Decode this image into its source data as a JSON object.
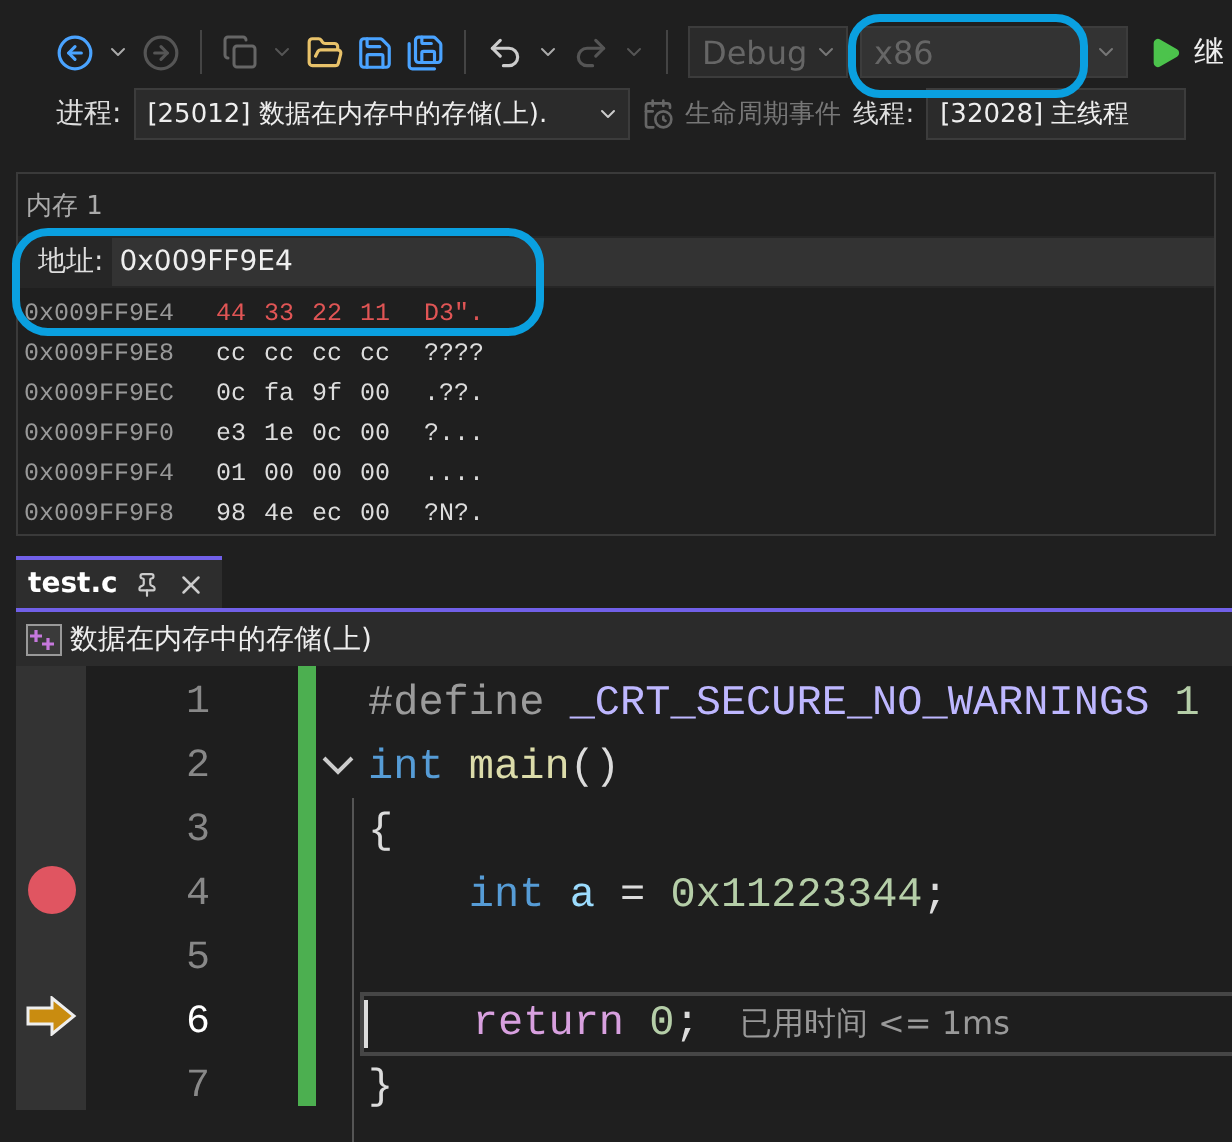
{
  "toolbar": {
    "configuration": "Debug",
    "platform": "x86",
    "run_label": "继"
  },
  "debug_location": {
    "process_label": "进程:",
    "process": "[25012] 数据在内存中的存储(上).",
    "lifecycle": "生命周期事件",
    "thread_label": "线程:",
    "thread": "[32028] 主线程"
  },
  "memory": {
    "title": "内存 1",
    "address_label": "地址:",
    "address": "0x009FF9E4",
    "rows": [
      {
        "address": "0x009FF9E4",
        "bytes": [
          "44",
          "33",
          "22",
          "11"
        ],
        "chars": "D3\".",
        "changed": true
      },
      {
        "address": "0x009FF9E8",
        "bytes": [
          "cc",
          "cc",
          "cc",
          "cc"
        ],
        "chars": "????",
        "changed": false
      },
      {
        "address": "0x009FF9EC",
        "bytes": [
          "0c",
          "fa",
          "9f",
          "00"
        ],
        "chars": ".??.",
        "changed": false
      },
      {
        "address": "0x009FF9F0",
        "bytes": [
          "e3",
          "1e",
          "0c",
          "00"
        ],
        "chars": "?...",
        "changed": false
      },
      {
        "address": "0x009FF9F4",
        "bytes": [
          "01",
          "00",
          "00",
          "00"
        ],
        "chars": "....",
        "changed": false
      },
      {
        "address": "0x009FF9F8",
        "bytes": [
          "98",
          "4e",
          "ec",
          "00"
        ],
        "chars": "?N?.",
        "changed": false
      }
    ]
  },
  "editor": {
    "tab": {
      "title": "test.c",
      "selected": true
    },
    "navigation": "数据在内存中的存储(上)",
    "lines": [
      {
        "number": "1",
        "breakpoint": false,
        "current": false,
        "fold": false,
        "tokens": [
          {
            "text": "#define",
            "kind": "preprocessor"
          },
          {
            "text": " _CRT_SECURE_NO_WARNINGS",
            "kind": "macro"
          },
          {
            "text": " 1",
            "kind": "number"
          }
        ]
      },
      {
        "number": "2",
        "breakpoint": false,
        "current": false,
        "fold": true,
        "tokens": [
          {
            "text": "int",
            "kind": "keyword"
          },
          {
            "text": " main",
            "kind": "function"
          },
          {
            "text": "()",
            "kind": "punctuation"
          }
        ]
      },
      {
        "number": "3",
        "breakpoint": false,
        "current": false,
        "fold": false,
        "tokens": [
          {
            "text": "{",
            "kind": "punctuation"
          }
        ]
      },
      {
        "number": "4",
        "breakpoint": true,
        "current": false,
        "fold": false,
        "tokens": [
          {
            "text": "    int",
            "kind": "keyword"
          },
          {
            "text": " a",
            "kind": "variable"
          },
          {
            "text": " = ",
            "kind": "punctuation"
          },
          {
            "text": "0x11223344",
            "kind": "number"
          },
          {
            "text": ";",
            "kind": "punctuation"
          }
        ]
      },
      {
        "number": "5",
        "breakpoint": false,
        "current": false,
        "fold": false
      },
      {
        "number": "6",
        "breakpoint": false,
        "current": true,
        "fold": false,
        "hint": "已用时间 <= 1ms",
        "tokens": [
          {
            "text": "    return",
            "kind": "control"
          },
          {
            "text": " 0",
            "kind": "number"
          },
          {
            "text": ";",
            "kind": "punctuation"
          }
        ]
      },
      {
        "number": "7",
        "breakpoint": false,
        "current": false,
        "fold": false,
        "tokens": [
          {
            "text": "}",
            "kind": "punctuation"
          }
        ]
      }
    ]
  }
}
